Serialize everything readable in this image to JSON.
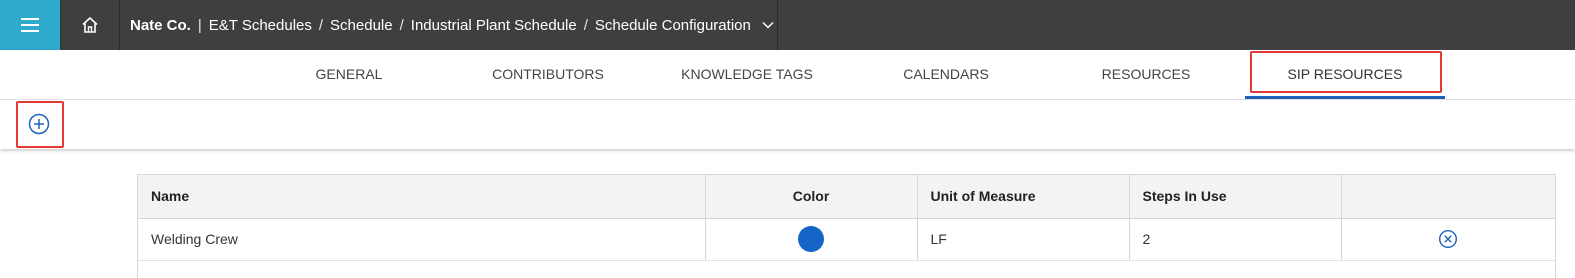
{
  "header": {
    "org": "Nate Co.",
    "separator_first": "|",
    "separator": "/",
    "breadcrumbs": [
      "E&T Schedules",
      "Schedule",
      "Industrial Plant Schedule",
      "Schedule Configuration"
    ],
    "menu_icon": "hamburger-icon",
    "home_icon": "home-icon",
    "dropdown_icon": "chevron-down-icon",
    "menu_color": "#2eaacd",
    "bar_color": "#3f3f3f"
  },
  "tabs": [
    {
      "label": "GENERAL"
    },
    {
      "label": "CONTRIBUTORS"
    },
    {
      "label": "KNOWLEDGE TAGS"
    },
    {
      "label": "CALENDARS"
    },
    {
      "label": "RESOURCES"
    },
    {
      "label": "SIP RESOURCES",
      "active": true
    }
  ],
  "toolbar": {
    "add_icon": "add-circle-icon"
  },
  "table": {
    "columns": [
      "Name",
      "Color",
      "Unit of Measure",
      "Steps In Use",
      ""
    ],
    "rows": [
      {
        "name": "Welding Crew",
        "color": "#1565c8",
        "unit": "LF",
        "steps": "2",
        "action_icon": "remove-circle-icon"
      }
    ]
  },
  "colors": {
    "accent": "#1e63b8",
    "highlight": "#e53935"
  }
}
